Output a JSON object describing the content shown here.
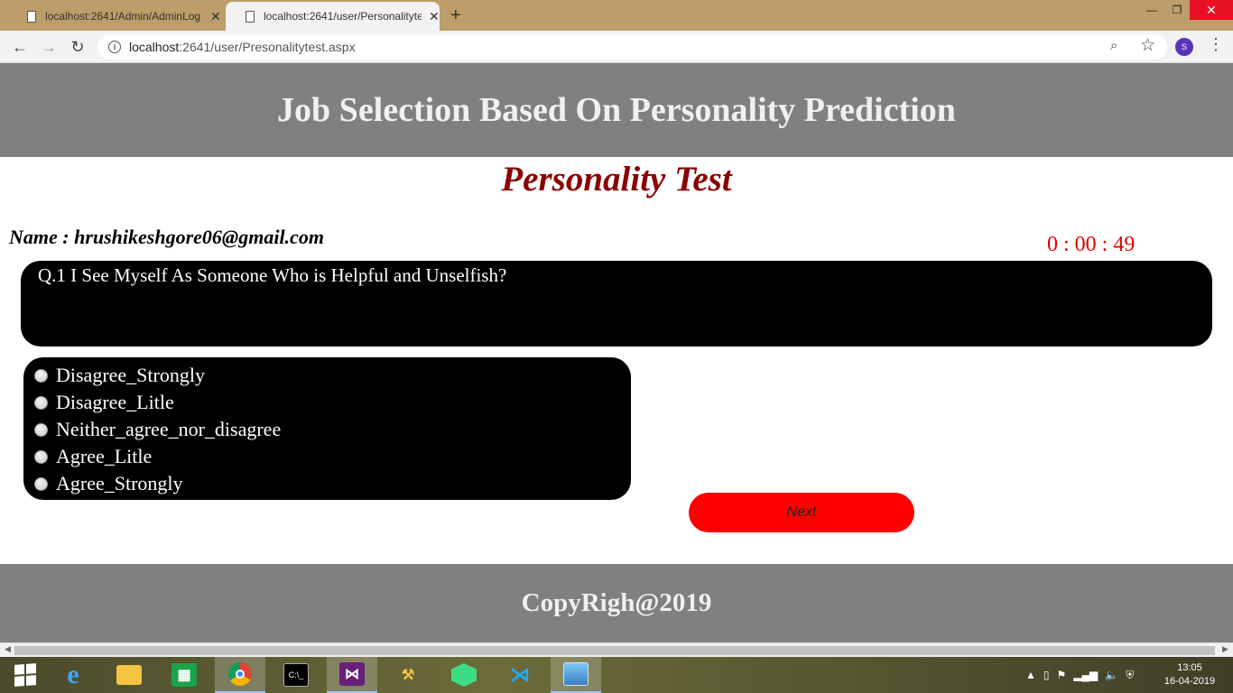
{
  "browser": {
    "tabs": [
      {
        "title": "localhost:2641/Admin/AdminLog",
        "active": false
      },
      {
        "title": "localhost:2641/user/Personalityte",
        "active": true
      }
    ],
    "url_host": "localhost",
    "url_rest": ":2641/user/Presonalitytest.aspx",
    "profile_initial": "S"
  },
  "header": {
    "title": "Job Selection Based On Personality Prediction"
  },
  "page": {
    "heading": "Personality Test",
    "name_line": "Name : hrushikeshgore06@gmail.com",
    "timer": "0 : 00 : 49"
  },
  "question": {
    "text": "Q.1 I See Myself As Someone Who is Helpful and Unselfish?"
  },
  "options": [
    "Disagree_Strongly",
    "Disagree_Litle",
    "Neither_agree_nor_disagree",
    "Agree_Litle",
    "Agree_Strongly"
  ],
  "next_button": "Next",
  "footer": {
    "text": "CopyRigh@2019"
  },
  "taskbar": {
    "time": "13:05",
    "date": "16-04-2019",
    "apps": [
      "start-icon",
      "internet-explorer-icon",
      "file-explorer-icon",
      "store-icon",
      "chrome-icon",
      "cmd-icon",
      "visual-studio-icon",
      "tools-icon",
      "android-studio-icon",
      "vscode-icon",
      "photos-icon"
    ]
  },
  "colors": {
    "header_bg": "#808080",
    "heading": "#8b0000",
    "timer": "#e00000",
    "next_button": "#ff0000",
    "box_bg": "#000000"
  }
}
